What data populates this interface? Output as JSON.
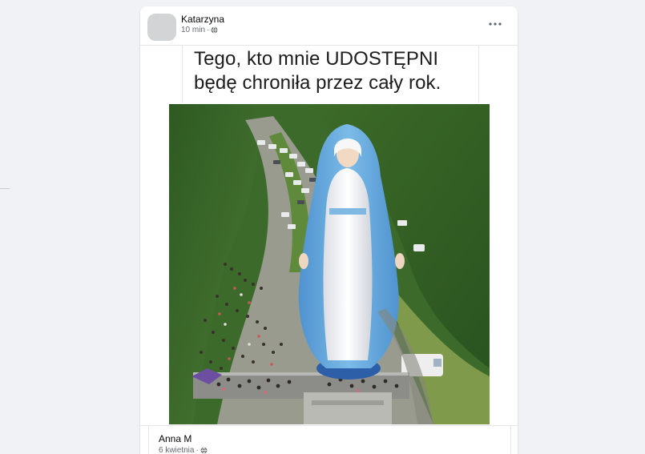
{
  "post": {
    "author": "Katarzyna",
    "time": "10 min",
    "separator": "·",
    "privacy_icon": "globe-icon",
    "more_icon": "ellipsis-icon",
    "caption_line1": "Tego, kto mnie UDOSTĘPNI",
    "caption_line2": "będę chroniła przez cały rok."
  },
  "comment": {
    "author": "Anna M",
    "date": "6 kwietnia",
    "separator": "·",
    "privacy_icon": "globe-icon"
  },
  "colors": {
    "page_bg": "#f0f2f5",
    "card_bg": "#ffffff",
    "secondary_text": "#65676b",
    "statue_robe": "#6aaee0",
    "statue_dress": "#f2f4f7"
  }
}
